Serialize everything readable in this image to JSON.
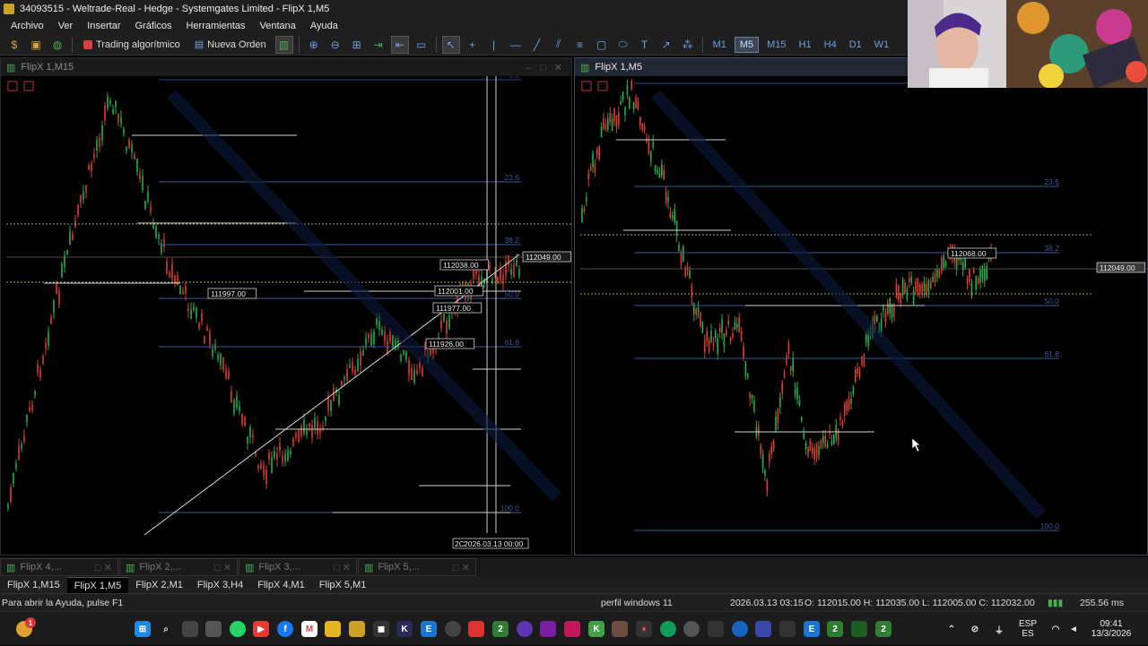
{
  "window": {
    "title": "34093515 - Weltrade-Real - Hedge - Systemgates Limited - FlipX 1,M5"
  },
  "menu": [
    "Archivo",
    "Ver",
    "Insertar",
    "Gráficos",
    "Herramientas",
    "Ventana",
    "Ayuda"
  ],
  "toolbar": {
    "algo_trading": "Trading algorítmico",
    "new_order": "Nueva Orden",
    "timeframes": [
      "M1",
      "M5",
      "M15",
      "H1",
      "H4",
      "D1",
      "W1"
    ],
    "active_timeframe": "M5"
  },
  "left_chart": {
    "title": "FlipX 1,M15",
    "fib_levels": [
      "0.0",
      "23.6",
      "38.2",
      "50.0",
      "61.8",
      "100.0"
    ],
    "price_tags": [
      "112038.00",
      "111997.00",
      "112001.00",
      "111977.00",
      "111926.00",
      "112049.00"
    ],
    "time_label": "2026.03.13 00:00",
    "time_label_prefix": "2C"
  },
  "right_chart": {
    "title": "FlipX 1,M5",
    "fib_levels": [
      "23.6",
      "38.2",
      "50.0",
      "61.8",
      "100.0"
    ],
    "price_tags": [
      "112068.00",
      "112049.00"
    ]
  },
  "minimized": [
    "FlipX 4,...",
    "FlipX 2,...",
    "FlipX 3,...",
    "FlipX 5,..."
  ],
  "chart_tabs": [
    "FlipX 1,M15",
    "FlipX 1,M5",
    "FlipX 2,M1",
    "FlipX 3,H4",
    "FlipX 4,M1",
    "FlipX 5,M1"
  ],
  "active_chart_tab": "FlipX 1,M5",
  "status": {
    "help": "Para abrir la Ayuda, pulse F1",
    "profile": "perfil windows 11",
    "datetime": "2026.03.13 03:15",
    "ohlc": "O: 112015.00  H: 112035.00  L: 112005.00  C: 112032.00",
    "ping": "255.56 ms"
  },
  "taskbar": {
    "lang_top": "ESP",
    "lang_bottom": "ES",
    "time": "09:41",
    "date": "13/3/2026",
    "notification_count": "1"
  },
  "colors": {
    "bull": "#22b14c",
    "bear": "#e03c31",
    "fib": "#3b5a9a",
    "accent": "#6aa0e8"
  }
}
